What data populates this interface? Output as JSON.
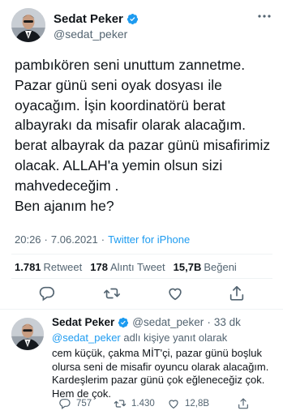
{
  "main_tweet": {
    "author_name": "Sedat Peker",
    "handle": "@sedat_peker",
    "text": "pambıkören seni unuttum zannetme.\nPazar günü seni oyak dosyası ile oyacağım. İşin koordinatörü berat albayrakı da misafir olarak alacağım. berat albayrak da pazar günü misafirimiz olacak. ALLAH'a yemin olsun sizi mahvedeceğim .\nBen ajanım he?",
    "time": "20:26",
    "date": "7.06.2021",
    "separator": "·",
    "source": "Twitter for iPhone",
    "stats": {
      "retweets_count": "1.781",
      "retweets_label": "Retweet",
      "quotes_count": "178",
      "quotes_label": "Alıntı Tweet",
      "likes_count": "15,7B",
      "likes_label": "Beğeni"
    },
    "icons": [
      "verified-badge-icon",
      "more-options-icon",
      "reply-icon",
      "retweet-icon",
      "like-icon",
      "share-icon"
    ]
  },
  "reply_tweet": {
    "author_name": "Sedat Peker",
    "handle": "@sedat_peker",
    "separator": "·",
    "age": "33 dk",
    "reply_to_mention": "@sedat_peker",
    "reply_to_suffix": "adlı kişiye yanıt olarak",
    "text": "cem küçük, çakma MİT'çi, pazar günü boşluk olursa seni de misafir oyuncu olarak alacağım.\nKardeşlerim pazar günü çok eğleneceğiz çok.\nHem de çok.",
    "reply_count": "757",
    "retweet_count": "1.430",
    "like_count": "12,8B"
  },
  "colors": {
    "accent": "#1d9bf0",
    "text": "#0f1419",
    "muted": "#536471",
    "divider": "#eff3f4"
  }
}
